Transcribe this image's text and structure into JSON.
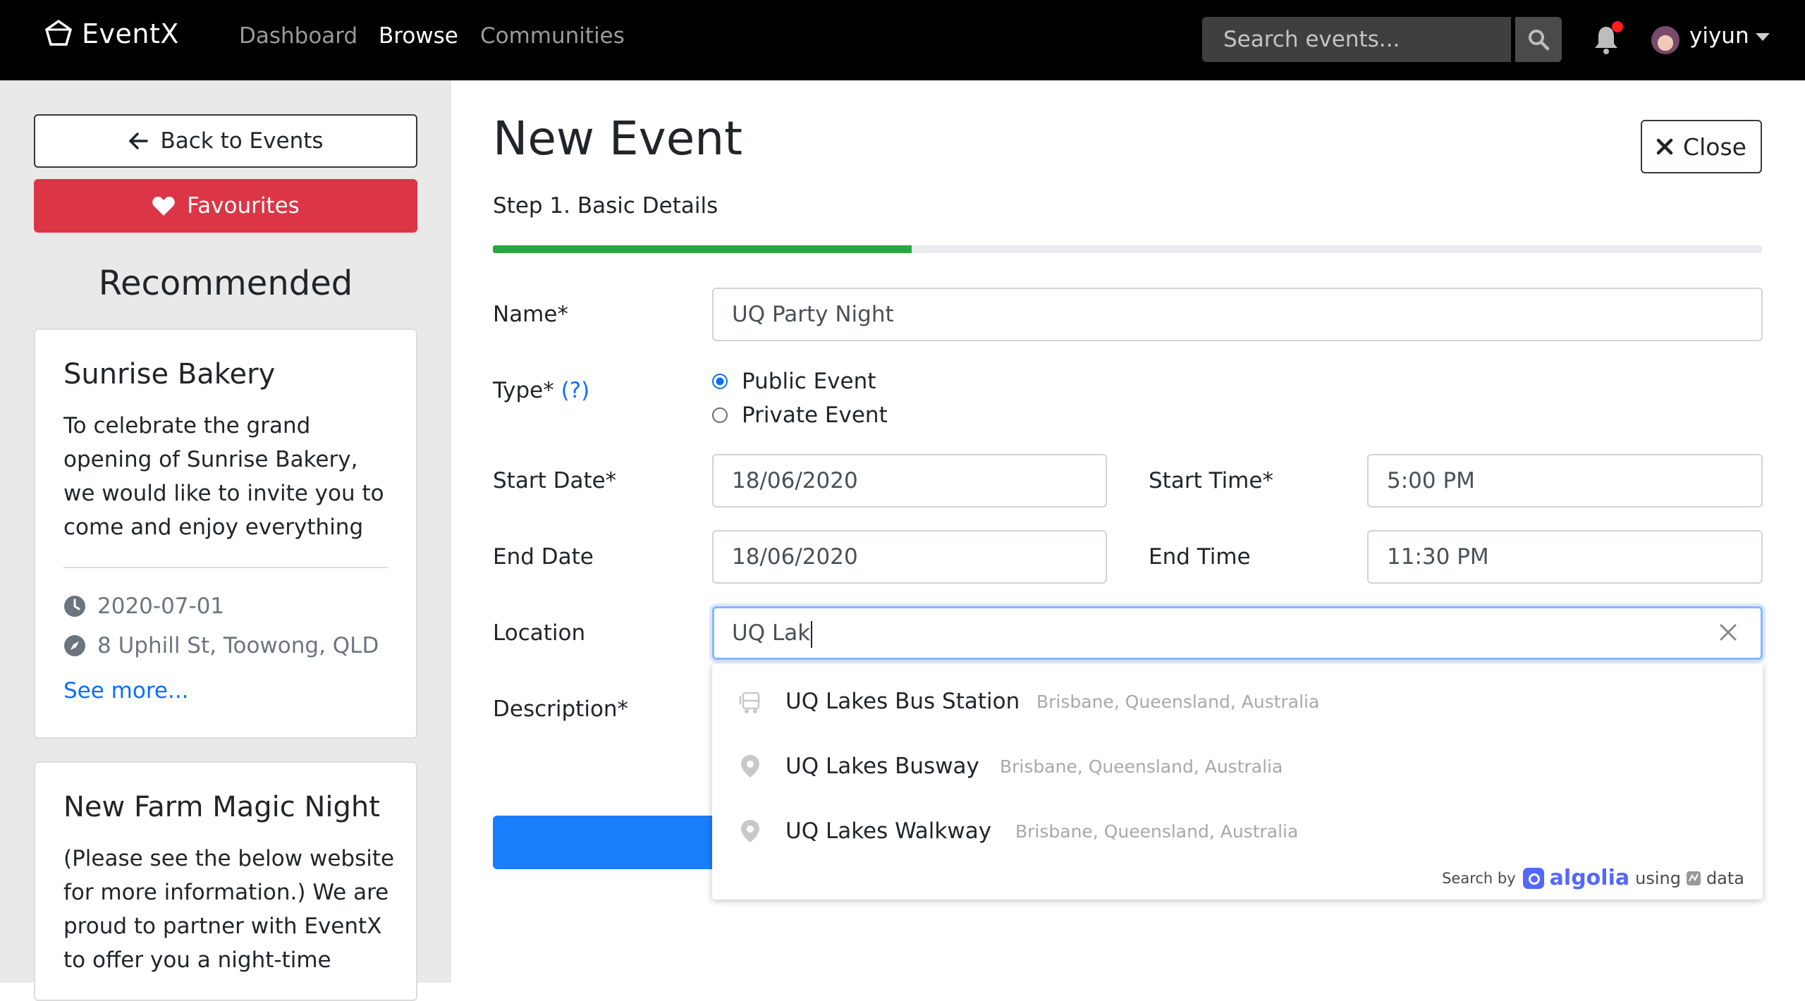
{
  "navbar": {
    "brand": "EventX",
    "links": [
      "Dashboard",
      "Browse",
      "Communities"
    ],
    "active_link": "Browse",
    "search_placeholder": "Search events...",
    "username": "yiyun",
    "notification_dot_color": "#ff1e1e"
  },
  "sidebar": {
    "back_label": "Back to Events",
    "favourites_label": "Favourites",
    "recommended_heading": "Recommended",
    "cards": [
      {
        "title": "Sunrise Bakery",
        "text": "To celebrate the grand opening of Sunrise Bakery, we would like to invite you to come and enjoy everything",
        "date": "2020-07-01",
        "location": "8 Uphill St, Toowong, QLD",
        "link": "See more..."
      },
      {
        "title": "New Farm Magic Night",
        "text": "(Please see the below website for more information.) We are proud to partner with EventX to offer you a night-time"
      }
    ]
  },
  "form": {
    "title": "New Event",
    "close_label": "Close",
    "step_label": "Step 1. Basic Details",
    "progress_fraction": 0.33,
    "progress_color": "#28a745",
    "name_label": "Name*",
    "name_value": "UQ Party Night",
    "type_label": "Type*",
    "type_help": "(?)",
    "type_options": [
      "Public Event",
      "Private Event"
    ],
    "type_selected": "Public Event",
    "start_date_label": "Start Date*",
    "start_date_value": "18/06/2020",
    "start_time_label": "Start Time*",
    "start_time_value": "5:00 PM",
    "end_date_label": "End Date",
    "end_date_value": "18/06/2020",
    "end_time_label": "End Time",
    "end_time_value": "11:30 PM",
    "location_label": "Location",
    "location_value": "UQ Lak",
    "description_label": "Description*"
  },
  "autocomplete": {
    "suggestions": [
      {
        "name": "UQ Lakes Bus Station",
        "detail": "Brisbane, Queensland, Australia",
        "icon": "bus-icon"
      },
      {
        "name": "UQ Lakes Busway",
        "detail": "Brisbane, Queensland, Australia",
        "icon": "map-pin-icon"
      },
      {
        "name": "UQ Lakes Walkway",
        "detail": "Brisbane, Queensland, Australia",
        "icon": "map-pin-icon"
      }
    ],
    "footer_search_by": "Search by",
    "footer_brand": "algolia",
    "footer_using": "using",
    "footer_data": "data"
  }
}
